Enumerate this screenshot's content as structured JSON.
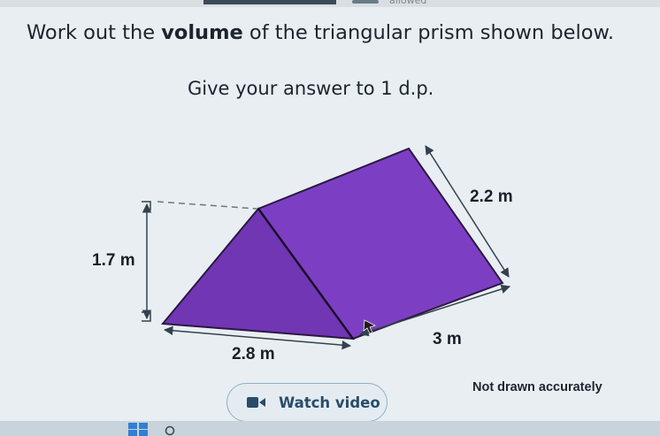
{
  "header": {
    "allowed_label": "allowed"
  },
  "question": {
    "text_before": "Work out the ",
    "text_bold": "volume",
    "text_after": " of the triangular prism shown below.",
    "instruction": "Give your answer to 1 d.p."
  },
  "figure": {
    "height_label": "1.7 m",
    "base_label": "2.8 m",
    "slant_label": "2.2 m",
    "length_label": "3 m",
    "note": "Not drawn accurately",
    "colors": {
      "face": "#7c3fc4",
      "edge": "#2c1742",
      "measure": "#33414d"
    }
  },
  "actions": {
    "watch_video_label": "Watch video",
    "accent": "#2a4c6a"
  },
  "taskbar": {
    "icons": [
      "windows-icon",
      "search-icon"
    ]
  }
}
